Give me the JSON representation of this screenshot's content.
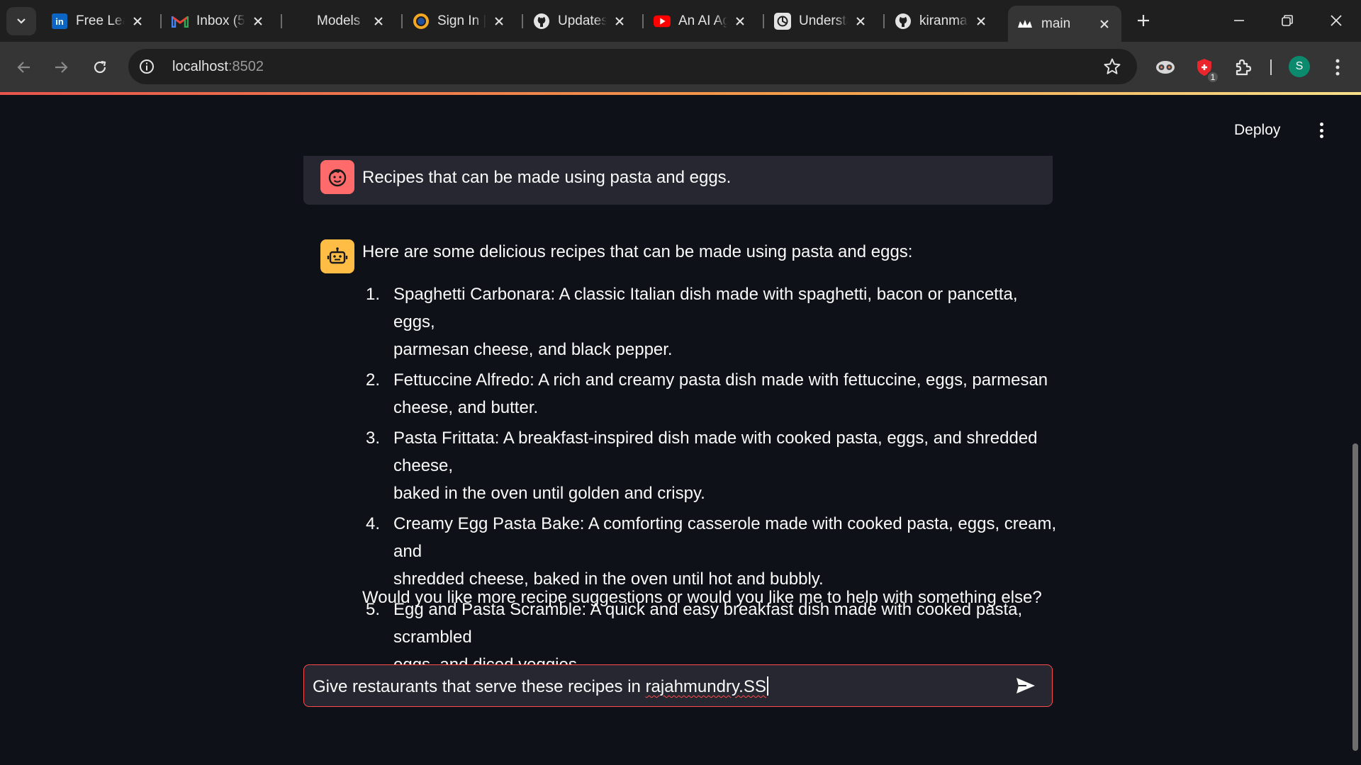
{
  "browser": {
    "tabs": [
      {
        "title": "Free Learning",
        "icon": "linkedin-icon"
      },
      {
        "title": "Inbox (5",
        "icon": "gmail-icon"
      },
      {
        "title": "Models",
        "icon": "blank-icon"
      },
      {
        "title": "Sign In | ",
        "icon": "orange-ring-icon"
      },
      {
        "title": "Updates",
        "icon": "github-icon"
      },
      {
        "title": "An AI Agent",
        "icon": "youtube-icon"
      },
      {
        "title": "Understanding",
        "icon": "openai-icon"
      },
      {
        "title": "kiranma",
        "icon": "github-icon"
      },
      {
        "title": "main",
        "icon": "streamlit-crown-icon",
        "active": true
      }
    ],
    "url_host": "localhost",
    "url_port": ":8502",
    "extension_badge": "1",
    "profile_initial": "S"
  },
  "app": {
    "deploy_label": "Deploy",
    "user_message": "Recipes that can be made using pasta and eggs.",
    "assistant": {
      "intro": "Here are some delicious recipes that can be made using pasta and eggs:",
      "items": [
        {
          "num": "1.",
          "line1": "Spaghetti Carbonara: A classic Italian dish made with spaghetti, bacon or pancetta, eggs,",
          "line2": "parmesan cheese, and black pepper."
        },
        {
          "num": "2.",
          "line1": "Fettuccine Alfredo: A rich and creamy pasta dish made with fettuccine, eggs, parmesan",
          "line2": "cheese, and butter."
        },
        {
          "num": "3.",
          "line1": "Pasta Frittata: A breakfast-inspired dish made with cooked pasta, eggs, and shredded cheese,",
          "line2": "baked in the oven until golden and crispy."
        },
        {
          "num": "4.",
          "line1": "Creamy Egg Pasta Bake: A comforting casserole made with cooked pasta, eggs, cream, and",
          "line2": "shredded cheese, baked in the oven until hot and bubbly."
        },
        {
          "num": "5.",
          "line1": "Egg and Pasta Scramble: A quick and easy breakfast dish made with cooked pasta, scrambled",
          "line2": "eggs, and diced veggies."
        }
      ],
      "outro": "Would you like more recipe suggestions or would you like me to help with something else?"
    },
    "chat_input": {
      "text_before": "Give restaurants that serve these recipes in ",
      "text_misspelled": "rajahmundry.SS"
    }
  },
  "colors": {
    "accent": "#ff4b4b",
    "user_avatar": "#ff6b6b",
    "bot_avatar": "#ffbd45",
    "background": "#0e1117",
    "surface": "#262730"
  }
}
